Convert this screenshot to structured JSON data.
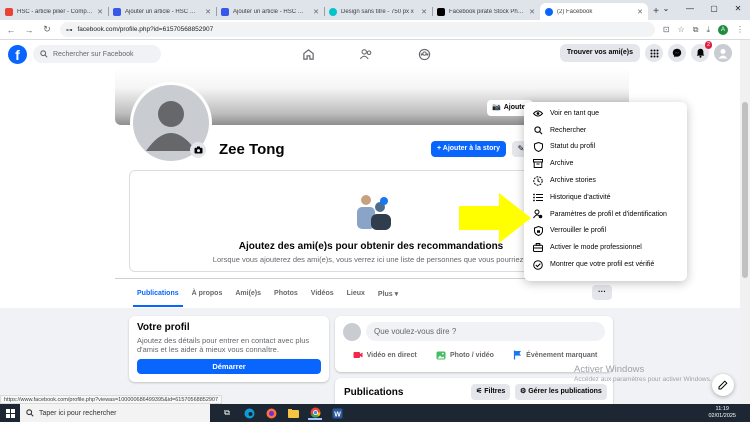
{
  "browser": {
    "tabs": [
      {
        "title": "HSC - article pilier - Comptes",
        "color": "#ea4335"
      },
      {
        "title": "Ajouter un article - HSC — W",
        "color": "#3858e9"
      },
      {
        "title": "Ajouter un article - HSC — W",
        "color": "#3858e9"
      },
      {
        "title": "Design sans titre - 750 px x",
        "color": "#00c4cc"
      },
      {
        "title": "Facebook piraté Stock Photo",
        "color": "#000000"
      },
      {
        "title": "(2) Facebook",
        "color": "#0866ff"
      }
    ],
    "new_tab": "+",
    "url": "facebook.com/profile.php?id=61570568852907",
    "account_initial": "A"
  },
  "header": {
    "logo": "f",
    "search_placeholder": "Rechercher sur Facebook",
    "find_friends": "Trouver vos ami(e)s",
    "notif_count": "2"
  },
  "profile": {
    "name": "Zee Tong",
    "edit_cover_label": "Ajouter",
    "add_story": "+ Ajouter à la story",
    "find_title": "Ajoutez des ami(e)s pour obtenir des recommandations",
    "find_sub": "Lorsque vous ajouterez des ami(e)s, vous verrez ici une liste de personnes que vous pourriez c",
    "tabs": [
      "Publications",
      "À propos",
      "Ami(e)s",
      "Photos",
      "Vidéos",
      "Lieux",
      "Plus ▾"
    ],
    "more_label": "···"
  },
  "menu": {
    "items": [
      {
        "label": "Voir en tant que",
        "icon": "eye-icon"
      },
      {
        "label": "Rechercher",
        "icon": "search-icon"
      },
      {
        "label": "Statut du profil",
        "icon": "shield-icon"
      },
      {
        "label": "Archive",
        "icon": "archive-icon"
      },
      {
        "label": "Archive stories",
        "icon": "clock-icon"
      },
      {
        "label": "Historique d'activité",
        "icon": "list-icon"
      },
      {
        "label": "Paramètres de profil et d'identification",
        "icon": "gear-person-icon"
      },
      {
        "label": "Verrouiller le profil",
        "icon": "lock-shield-icon"
      },
      {
        "label": "Activer le mode professionnel",
        "icon": "briefcase-icon"
      },
      {
        "label": "Montrer que votre profil est vérifié",
        "icon": "check-circle-icon"
      }
    ]
  },
  "votre_profil": {
    "title": "Votre profil",
    "desc": "Ajoutez des détails pour entrer en contact avec plus d'amis et les aider à mieux vous connaître.",
    "button": "Démarrer"
  },
  "composer": {
    "placeholder": "Que voulez-vous dire ?",
    "actions": [
      "Vidéo en direct",
      "Photo / vidéo",
      "Évènement marquant"
    ]
  },
  "publications": {
    "title": "Publications",
    "filters": "Filtres",
    "manage": "Gérer les publications"
  },
  "watermark": {
    "line1": "Activer Windows",
    "line2": "Accédez aux paramètres pour activer Windows."
  },
  "status_url": "https://www.facebook.com/profile.php?viewas=100000686499395&id=61570568852907",
  "taskbar": {
    "search": "Taper ici pour rechercher",
    "time": "11:19",
    "date": "02/01/2025"
  },
  "colors": {
    "accent": "#0866ff",
    "arrow": "#ffff00"
  }
}
